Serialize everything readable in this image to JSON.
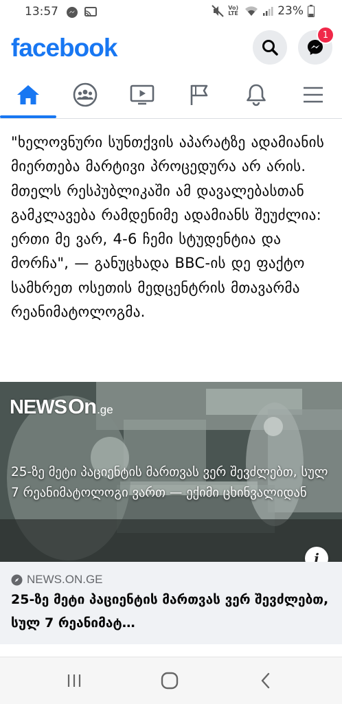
{
  "status_bar": {
    "time": "13:57",
    "lte_label": "Vo) LTE",
    "battery": "23%"
  },
  "header": {
    "logo": "facebook",
    "messenger_badge": "1"
  },
  "tabs": [
    {
      "name": "home",
      "active": true
    },
    {
      "name": "groups"
    },
    {
      "name": "watch"
    },
    {
      "name": "pages"
    },
    {
      "name": "notifications"
    },
    {
      "name": "menu"
    }
  ],
  "colors": {
    "brand": "#1877f2",
    "badge": "#f02849"
  },
  "post": {
    "text": "\"ხელოვნური სუნთქვის აპარატზე ადამიანის მიერთება მარტივი პროცედურა არ არის. მთელს რესპუბლიკაში ამ დავალებასთან გამკლავება რამდენიმე ადამიანს შეუძლია: ერთი მე ვარ, 4-6 ჩემი სტუდენტია და მორჩა\", — განუცხადა BBC-ის დე ფაქტო სამხრეთ ოსეთის მედცენტრის მთავარმა რეანიმატოლოგმა."
  },
  "media": {
    "logo_news": "NEWS",
    "logo_on": "On",
    "logo_ge": ".ge",
    "caption": "25-ზე მეტი პაციენტის მართვას ვერ შევძლებთ, სულ 7 რეანიმატოლოგი ვართ — ექიმი ცხინვალიდან",
    "info_label": "i"
  },
  "link_preview": {
    "domain": "NEWS.ON.GE",
    "title": "25-ზე მეტი პაციენტის მართვას ვერ შევძლებთ, სულ 7 რეანიმატ…"
  }
}
